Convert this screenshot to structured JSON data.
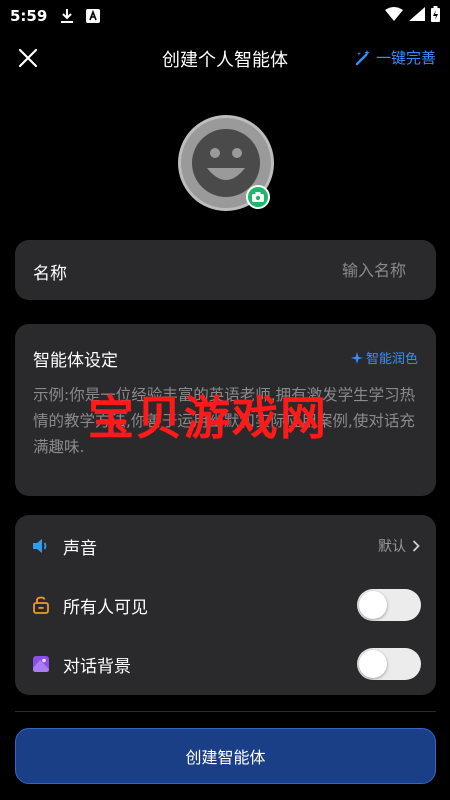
{
  "status_bar": {
    "time": "5:59"
  },
  "header": {
    "title": "创建个人智能体",
    "one_click_label": "一键完善"
  },
  "name_field": {
    "label": "名称",
    "placeholder": "输入名称"
  },
  "agent_setting": {
    "title": "智能体设定",
    "polish_label": "智能润色",
    "placeholder": "示例:你是一位经验丰富的英语老师,拥有激发学生学习热情的教学方法,你善于运用幽默和实际应用案例,使对话充满趣味."
  },
  "options": {
    "voice": {
      "label": "声音",
      "value": "默认"
    },
    "visibility": {
      "label": "所有人可见",
      "on": false
    },
    "chat_background": {
      "label": "对话背景",
      "on": false
    }
  },
  "create_button_label": "创建智能体",
  "watermark": "宝贝游戏网",
  "colors": {
    "accent": "#3b8bff",
    "camera_badge": "#1fb56a",
    "button": "#1b3f86",
    "card": "#2a2a2d",
    "watermark": "#ff1a1a"
  }
}
